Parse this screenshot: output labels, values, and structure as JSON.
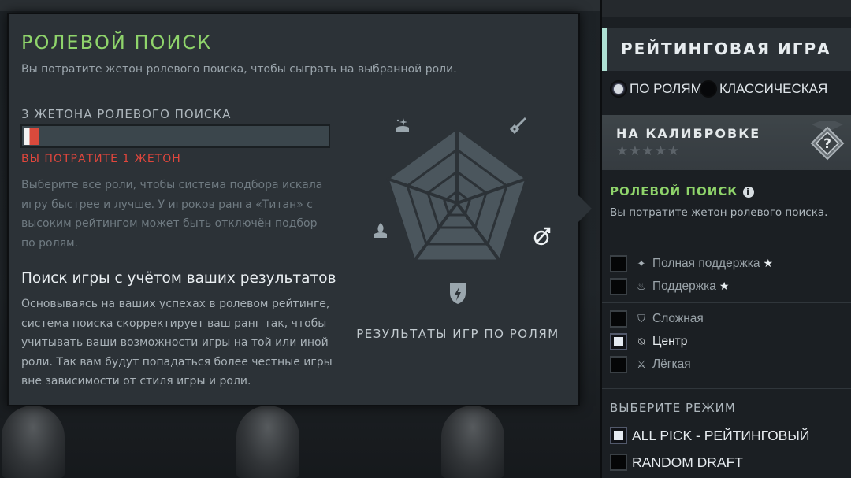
{
  "popup": {
    "title": "РОЛЕВОЙ ПОИСК",
    "subtitle": "Вы потратите жетон ролевого поиска, чтобы сыграть на выбранной роли.",
    "tokens_label": "3 ЖЕТОНА РОЛЕВОГО ПОИСКА",
    "tokens_fraction": 0.05,
    "spend_warning": "ВЫ ПОТРАТИТЕ 1 ЖЕТОН",
    "description": "Выберите все роли, чтобы система подбора искала игру быстрее и лучше. У игроков ранга «Титан» с высоким рейтингом может быть отключён подбор по ролям.",
    "performance_heading": "Поиск игры с учётом ваших результатов",
    "performance_body": "Основываясь на ваших успехах в ролевом рейтинге, система поиска скорректирует ваш ранг так, чтобы учитывать ваши возможности игры на той или иной роли. Так вам будут попадаться более честные игры вне зависимости от стиля игры и роли.",
    "radar_caption": "РЕЗУЛЬТАТЫ ИГР ПО РОЛЯМ",
    "radar_icons": [
      "hard-support-icon",
      "safe-lane-icon",
      "mid-lane-icon",
      "off-lane-icon",
      "soft-support-icon"
    ]
  },
  "panel": {
    "header": "РЕЙТИНГОВАЯ ИГРА",
    "modes": [
      {
        "label": "ПО РОЛЯМ",
        "selected": true
      },
      {
        "label": "КЛАССИЧЕСКАЯ",
        "selected": false
      }
    ],
    "calibration": "НА КАЛИБРОВКЕ",
    "calibration_stars": "★★★★★",
    "rank_badge": "?",
    "role_search_title": "РОЛЕВОЙ ПОИСК",
    "role_search_sub": "Вы потратите жетон ролевого поиска.",
    "roles": [
      {
        "label": "Полная поддержка",
        "icon": "hard-support-icon",
        "glyph": "✦",
        "checked": false,
        "star": "★"
      },
      {
        "label": "Поддержка",
        "icon": "soft-support-icon",
        "glyph": "♨",
        "checked": false,
        "star": "★"
      },
      {
        "label": "Сложная",
        "icon": "off-lane-icon",
        "glyph": "⛉",
        "checked": false,
        "star": ""
      },
      {
        "label": "Центр",
        "icon": "mid-lane-icon",
        "glyph": "⍉",
        "checked": true,
        "star": ""
      },
      {
        "label": "Лёгкая",
        "icon": "safe-lane-icon",
        "glyph": "⚔",
        "checked": false,
        "star": ""
      }
    ],
    "mode_select_title": "ВЫБЕРИТЕ РЕЖИМ",
    "game_modes": [
      {
        "label": "ALL PICK - РЕЙТИНГОВЫЙ",
        "checked": true
      },
      {
        "label": "RANDOM DRAFT",
        "checked": false
      }
    ]
  },
  "colors": {
    "accent_green": "#8fd46b",
    "warning_red": "#e0463c",
    "header_accent": "#aee0d3"
  }
}
